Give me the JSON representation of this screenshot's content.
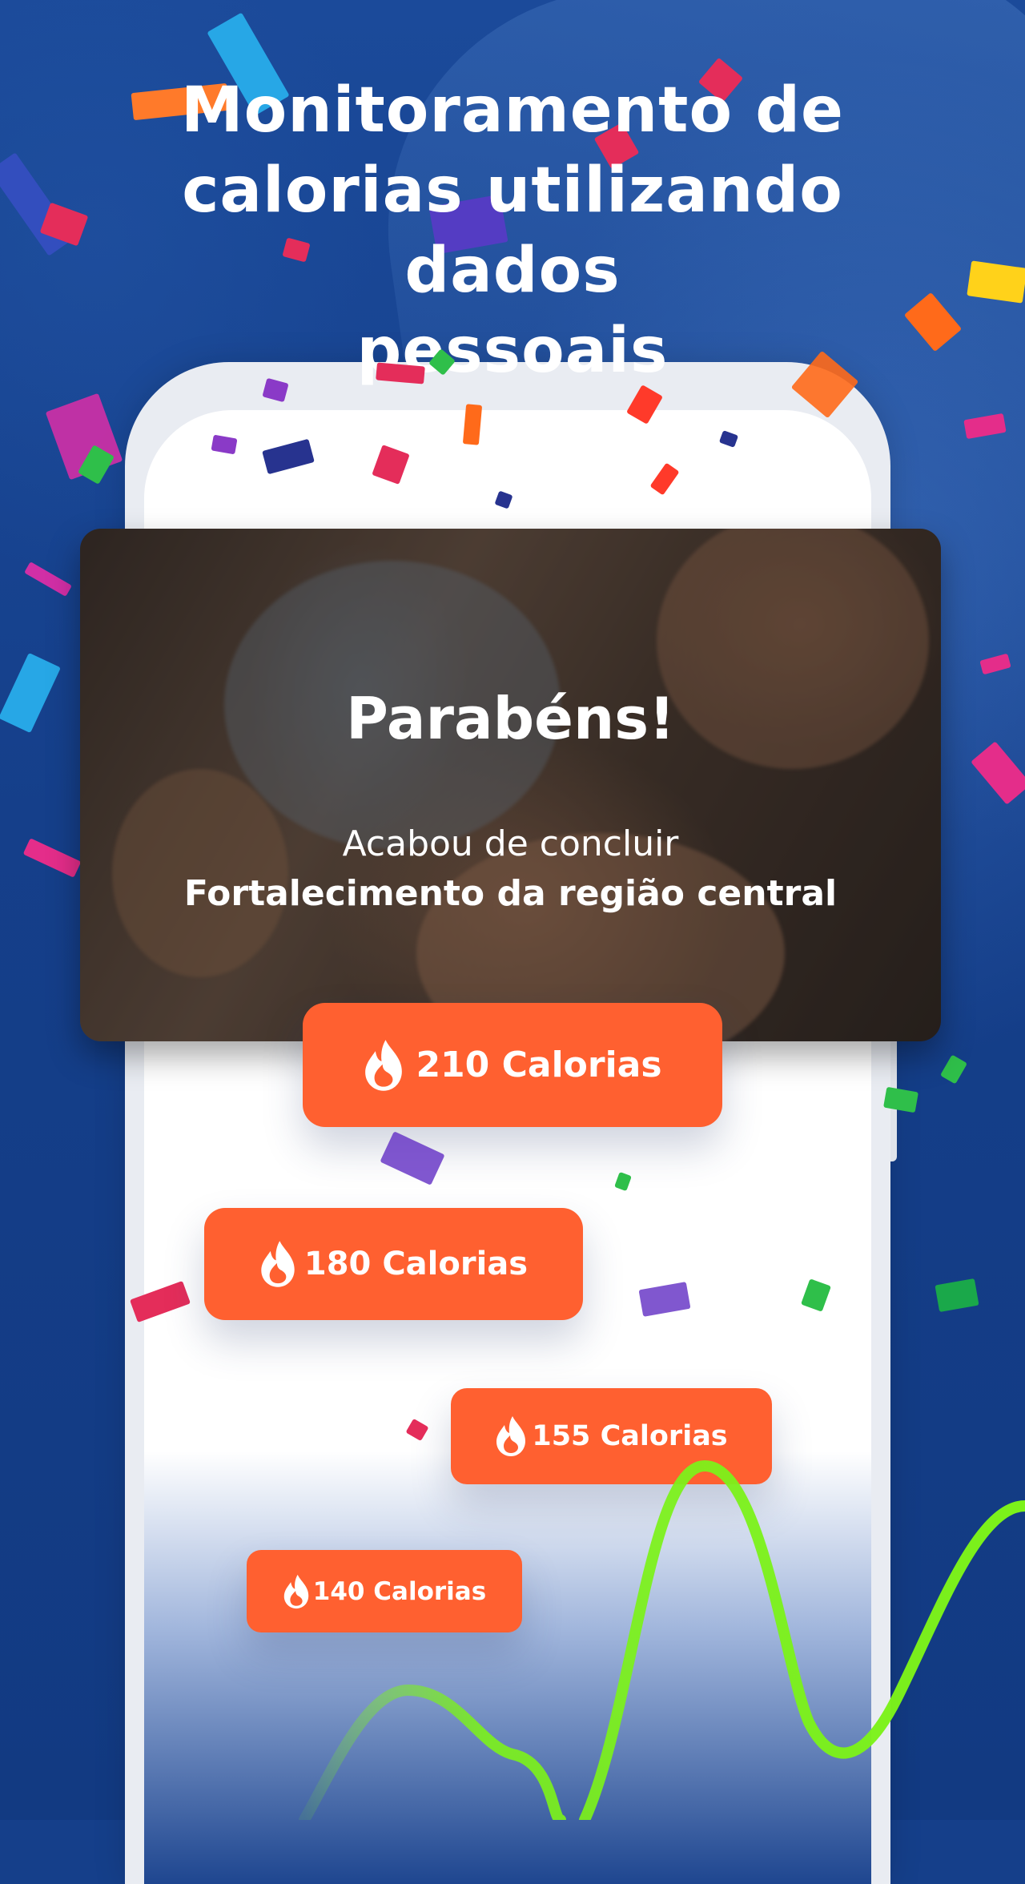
{
  "headline": "Monitoramento de\ncalorias utilizando dados\npessoais",
  "card": {
    "title": "Parabéns!",
    "subtitle": "Acabou de concluir",
    "workout": "Fortalecimento da região central"
  },
  "calorie_badges": [
    {
      "label": "210 Calorias",
      "icon": "flame-icon"
    },
    {
      "label": "180 Calorias",
      "icon": "flame-icon"
    },
    {
      "label": "155 Calorias",
      "icon": "flame-icon"
    },
    {
      "label": "140 Calorias",
      "icon": "flame-icon"
    }
  ],
  "colors": {
    "background": "#153f8a",
    "accent_orange": "#ff6030",
    "wave_green": "#7cf21a"
  }
}
